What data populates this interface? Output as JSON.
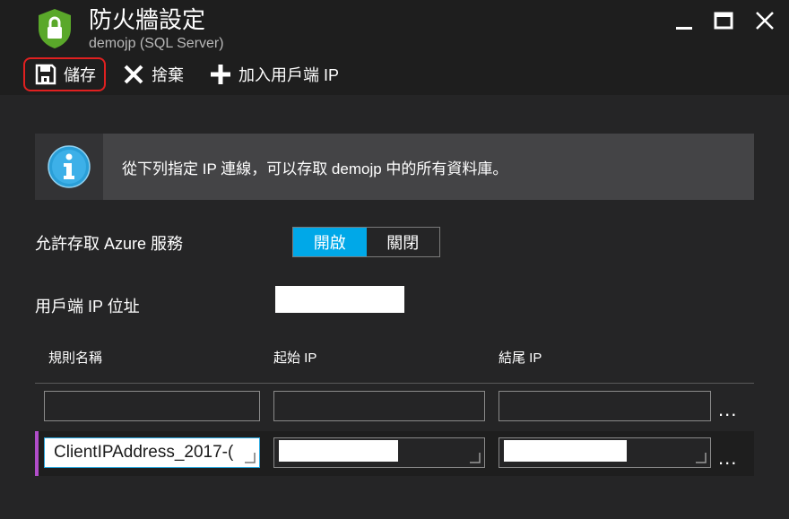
{
  "window": {
    "title": "防火牆設定",
    "subtitle": "demojp (SQL Server)"
  },
  "toolbar": {
    "save_label": "儲存",
    "discard_label": "捨棄",
    "add_client_ip_label": "加入用戶端 IP"
  },
  "info": {
    "message": "從下列指定 IP 連線，可以存取 demojp 中的所有資料庫。"
  },
  "azure_access": {
    "label": "允許存取 Azure 服務",
    "on_label": "開啟",
    "off_label": "關閉",
    "selected": "開啟"
  },
  "client_ip": {
    "label": "用戶端 IP 位址"
  },
  "rules_table": {
    "columns": [
      "規則名稱",
      "起始 IP",
      "結尾 IP"
    ],
    "rows": [
      {
        "name": "ClientIPAddress_2017-("
      }
    ],
    "more_label": "..."
  },
  "colors": {
    "accent": "#00a8e8",
    "shield": "#5aa82a",
    "row_marker": "#b14dc9",
    "save_highlight": "#e02020"
  }
}
